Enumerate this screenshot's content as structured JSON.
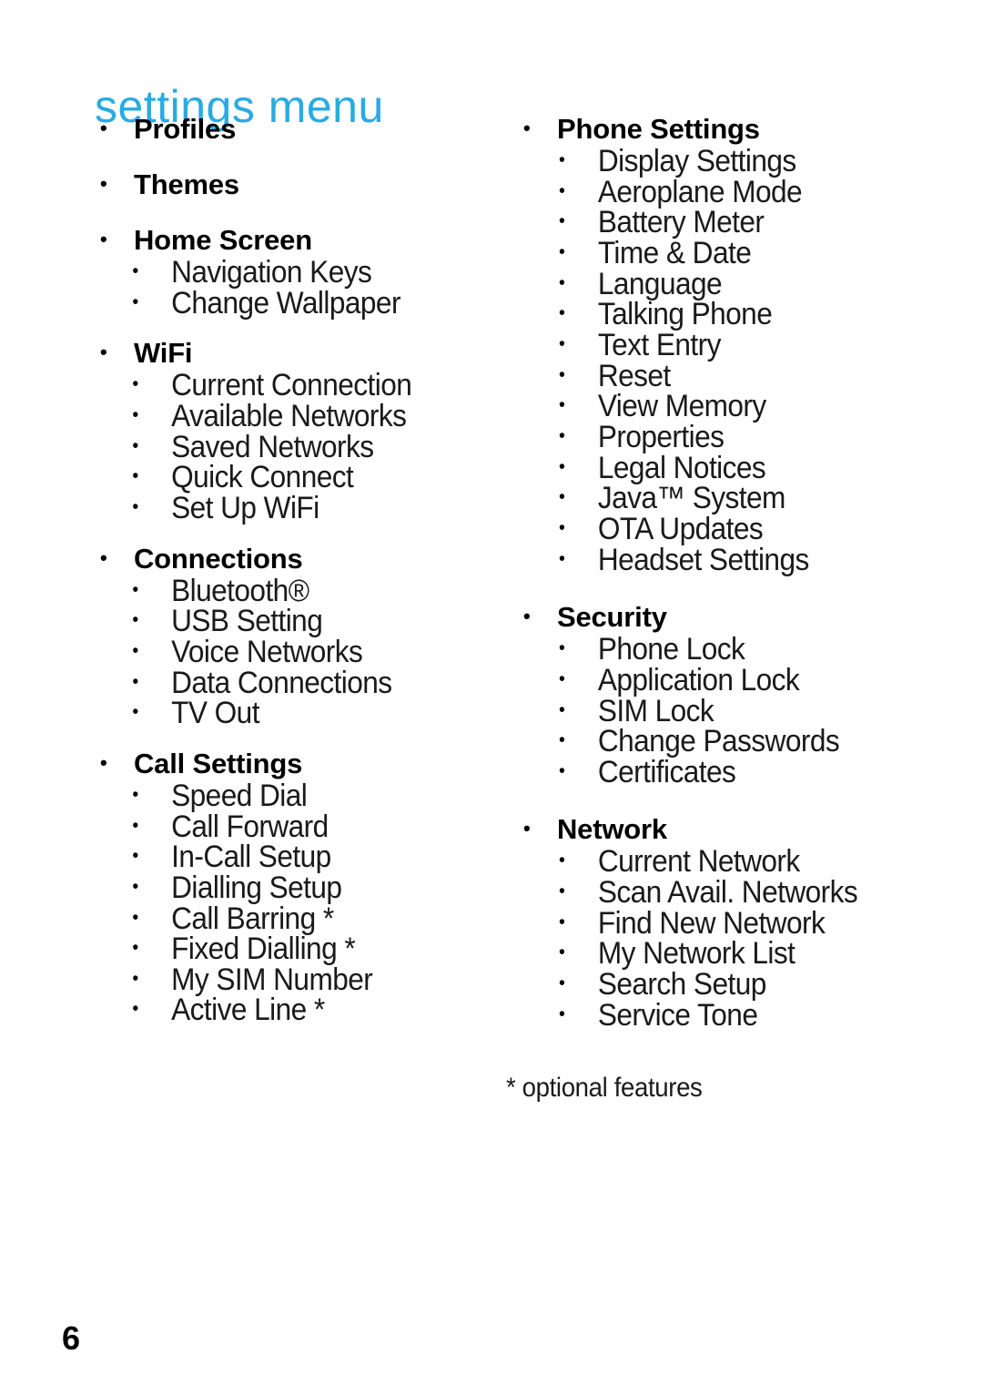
{
  "document": {
    "title": "settings menu",
    "title_color": "#29abe2",
    "page_number": "6",
    "footnote": "* optional features",
    "bullet_glyph": "•"
  },
  "columns": [
    {
      "name": "left-column",
      "groups": [
        {
          "heading": "Profiles",
          "items": []
        },
        {
          "heading": "Themes",
          "items": []
        },
        {
          "heading": "Home Screen",
          "items": [
            "Navigation Keys",
            "Change Wallpaper"
          ]
        },
        {
          "heading": "WiFi",
          "items": [
            "Current Connection",
            "Available Networks",
            "Saved Networks",
            "Quick Connect",
            "Set Up WiFi"
          ]
        },
        {
          "heading": "Connections",
          "items": [
            "Bluetooth®",
            "USB Setting",
            "Voice Networks",
            "Data Connections",
            "TV Out"
          ]
        },
        {
          "heading": "Call Settings",
          "items": [
            "Speed Dial",
            "Call Forward",
            "In-Call Setup",
            "Dialling Setup",
            "Call Barring *",
            "Fixed Dialling *",
            "My SIM Number",
            "Active Line *"
          ]
        }
      ]
    },
    {
      "name": "right-column",
      "groups": [
        {
          "heading": "Phone Settings",
          "items": [
            "Display Settings",
            "Aeroplane Mode",
            "Battery Meter",
            "Time & Date",
            "Language",
            "Talking Phone",
            "Text Entry",
            "Reset",
            "View Memory",
            "Properties",
            "Legal Notices",
            "Java™ System",
            "OTA Updates",
            "Headset Settings"
          ]
        },
        {
          "heading": "Security",
          "items": [
            "Phone Lock",
            "Application Lock",
            "SIM Lock",
            "Change Passwords",
            "Certificates"
          ]
        },
        {
          "heading": "Network",
          "items": [
            "Current Network",
            "Scan Avail. Networks",
            "Find New Network",
            "My Network List",
            "Search Setup",
            "Service Tone"
          ]
        }
      ]
    }
  ]
}
